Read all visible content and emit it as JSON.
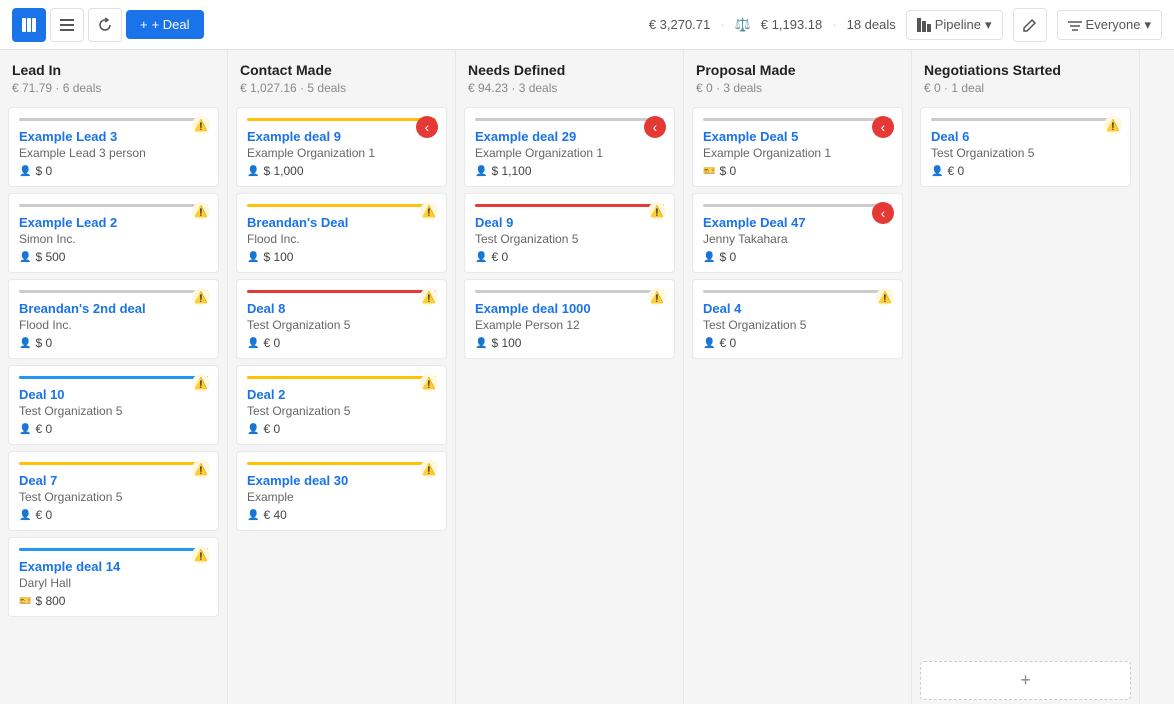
{
  "toolbar": {
    "add_deal_label": "+ Deal",
    "total_value": "€ 3,270.71",
    "weighted_value": "€ 1,193.18",
    "deals_count": "18 deals",
    "pipeline_label": "Pipeline",
    "everyone_label": "Everyone"
  },
  "columns": [
    {
      "id": "lead-in",
      "title": "Lead In",
      "meta": "€ 71.79 · 6 deals",
      "cards": [
        {
          "id": "example-lead-3",
          "bar_color": "#ccc",
          "title": "Example Lead 3",
          "org": "Example Lead 3 person",
          "amount": "$ 0",
          "warn": true,
          "action": false
        },
        {
          "id": "example-lead-2",
          "bar_color": "#ccc",
          "title": "Example Lead 2",
          "org": "Simon Inc.",
          "amount": "$ 500",
          "warn": true,
          "action": false
        },
        {
          "id": "breandens-2nd",
          "bar_color": "#ccc",
          "title": "Breandan's 2nd deal",
          "org": "Flood Inc.",
          "amount": "$ 0",
          "warn": true,
          "action": false
        },
        {
          "id": "deal-10",
          "bar_color": "#2196f3",
          "title": "Deal 10",
          "org": "Test Organization 5",
          "amount": "€ 0",
          "warn": true,
          "action": false
        },
        {
          "id": "deal-7",
          "bar_color": "#ffc107",
          "title": "Deal 7",
          "org": "Test Organization 5",
          "amount": "€ 0",
          "warn": true,
          "action": false
        },
        {
          "id": "example-deal-14",
          "bar_color": "#2196f3",
          "title": "Example deal 14",
          "org": "Daryl Hall",
          "amount": "$ 800",
          "warn": true,
          "action": false,
          "money_icon": true
        }
      ]
    },
    {
      "id": "contact-made",
      "title": "Contact Made",
      "meta": "€ 1,027.16 · 5 deals",
      "cards": [
        {
          "id": "example-deal-9",
          "bar_color": "#ffc107",
          "title": "Example deal 9",
          "org": "Example Organization 1",
          "amount": "$ 1,000",
          "warn": false,
          "action": true,
          "action_type": "left"
        },
        {
          "id": "breandens-deal",
          "bar_color": "#ffc107",
          "title": "Breandan's Deal",
          "org": "Flood Inc.",
          "amount": "$ 100",
          "warn": true,
          "action": false
        },
        {
          "id": "deal-8",
          "bar_color": "#e53935",
          "title": "Deal 8",
          "org": "Test Organization 5",
          "amount": "€ 0",
          "warn": true,
          "action": false
        },
        {
          "id": "deal-2",
          "bar_color": "#ffc107",
          "title": "Deal 2",
          "org": "Test Organization 5",
          "amount": "€ 0",
          "warn": true,
          "action": false
        },
        {
          "id": "example-deal-30",
          "bar_color": "#ffc107",
          "title": "Example deal 30",
          "org": "Example",
          "amount": "€ 40",
          "warn": true,
          "action": false
        }
      ]
    },
    {
      "id": "needs-defined",
      "title": "Needs Defined",
      "meta": "€ 94.23 · 3 deals",
      "cards": [
        {
          "id": "example-deal-29",
          "bar_color": "#ccc",
          "title": "Example deal 29",
          "org": "Example Organization 1",
          "amount": "$ 1,100",
          "warn": false,
          "action": true,
          "action_type": "left"
        },
        {
          "id": "deal-9",
          "bar_color": "#e53935",
          "title": "Deal 9",
          "org": "Test Organization 5",
          "amount": "€ 0",
          "warn": true,
          "action": false
        },
        {
          "id": "example-deal-1000",
          "bar_color": "#ccc",
          "title": "Example deal 1000",
          "org": "Example Person 12",
          "amount": "$ 100",
          "warn": true,
          "action": false
        }
      ]
    },
    {
      "id": "proposal-made",
      "title": "Proposal Made",
      "meta": "€ 0 · 3 deals",
      "cards": [
        {
          "id": "example-deal-5",
          "bar_color": "#ccc",
          "title": "Example Deal 5",
          "org": "Example Organization 1",
          "amount": "$ 0",
          "warn": false,
          "action": true,
          "action_type": "left",
          "money_icon": true
        },
        {
          "id": "example-deal-47",
          "bar_color": "#ccc",
          "title": "Example Deal 47",
          "org": "Jenny Takahara",
          "amount": "$ 0",
          "warn": false,
          "action": true,
          "action_type": "left"
        },
        {
          "id": "deal-4",
          "bar_color": "#ccc",
          "title": "Deal 4",
          "org": "Test Organization 5",
          "amount": "€ 0",
          "warn": true,
          "action": false
        }
      ]
    },
    {
      "id": "negotiations-started",
      "title": "Negotiations Started",
      "meta": "€ 0 · 1 deal",
      "cards": [
        {
          "id": "deal-6",
          "bar_color": "#ccc",
          "title": "Deal 6",
          "org": "Test Organization 5",
          "amount": "€ 0",
          "warn": true,
          "action": false
        }
      ]
    }
  ]
}
